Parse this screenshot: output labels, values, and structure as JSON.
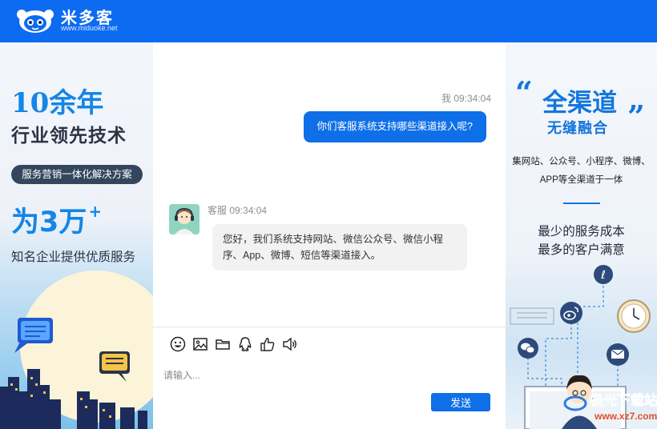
{
  "header": {
    "brand_name": "米多客",
    "brand_url": "www.miduoke.net",
    "color": "#0d6bf2"
  },
  "left_promo": {
    "years": "10余年",
    "lead": "行业领先技术",
    "pill": "服务营销一体化解决方案",
    "count": "为3万",
    "count_plus": "+",
    "service": "知名企业提供优质服务"
  },
  "chat": {
    "messages": [
      {
        "sender": "我",
        "time": "09:34:04",
        "meta": "我 09:34:04",
        "text": "你们客服系统支持哪些渠道接入呢?"
      },
      {
        "sender": "客服",
        "time": "09:34:04",
        "meta": "客服 09:34:04",
        "text": "您好，我们系统支持网站、微信公众号、微信小程序、App、微博、短信等渠道接入。"
      }
    ]
  },
  "composer": {
    "tools": [
      "emoji-icon",
      "image-icon",
      "folder-icon",
      "qq-icon",
      "thumbs-up-icon",
      "speaker-icon"
    ],
    "placeholder": "请输入...",
    "value": "",
    "send_label": "发送"
  },
  "right_promo": {
    "quote_open": "“",
    "quote_close": "”",
    "title": "全渠道",
    "subtitle": "无缝融合",
    "channels_line1": "集网站、公众号、小程序、微博、",
    "channels_line2": "APP等全渠道于一体",
    "cost_line1": "最少的服务成本",
    "cost_line2": "最多的客户满意"
  },
  "watermark": {
    "text": "极光下载站",
    "url": "www.xz7.com"
  },
  "colors": {
    "accent": "#0f6fe8",
    "promo_blue": "#1486e6",
    "agent_bubble": "#f2f2f2"
  }
}
